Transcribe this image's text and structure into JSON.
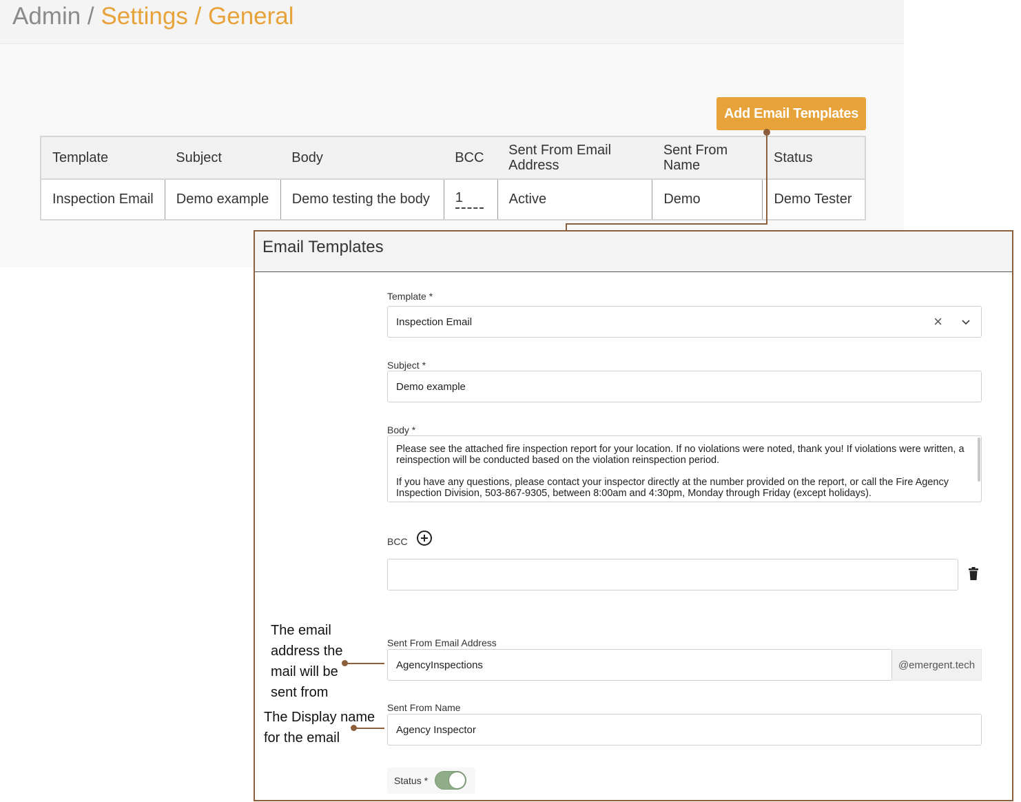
{
  "breadcrumb": {
    "root": "Admin / ",
    "section": "Settings / General"
  },
  "toolbar": {
    "add_label": "Add Email Templates"
  },
  "table": {
    "headers": [
      "Template",
      "Subject",
      "Body",
      "BCC",
      "Sent From Email Address",
      "Sent From Name",
      "Status"
    ],
    "rows": [
      [
        "Inspection Email",
        "Demo example",
        "Demo testing the body",
        "1",
        "Active",
        "Demo",
        "Demo Tester"
      ]
    ]
  },
  "modal": {
    "title": "Email Templates",
    "template": {
      "label": "Template *",
      "value": "Inspection Email"
    },
    "subject": {
      "label": "Subject *",
      "value": "Demo example"
    },
    "body": {
      "label": "Body *",
      "paragraph1": "Please see the attached fire inspection report for your location. If no violations were noted, thank you! If violations were written, a reinspection will be conducted based on the violation reinspection period.",
      "paragraph2": "If you have any questions, please contact your inspector directly at the number provided on the report, or call the Fire Agency Inspection Division, 503-867-9305, between 8:00am and 4:30pm, Monday through Friday (except holidays)."
    },
    "bcc": {
      "label": "BCC",
      "value": ""
    },
    "sender_email": {
      "label": "Sent From Email Address",
      "value": "AgencyInspections",
      "suffix": "@emergent.tech"
    },
    "sender_name": {
      "label": "Sent From Name",
      "value": "Agency Inspector"
    },
    "status": {
      "label": "Status *",
      "enabled": true
    }
  },
  "annotations": {
    "email_note": [
      "The email",
      "address the",
      "mail will be",
      "sent from"
    ],
    "name_note": [
      "The Display name",
      "for the email"
    ]
  },
  "colors": {
    "accent": "#e8a23a",
    "connector": "#8b5e3c",
    "toggle_on": "#8fae88"
  }
}
